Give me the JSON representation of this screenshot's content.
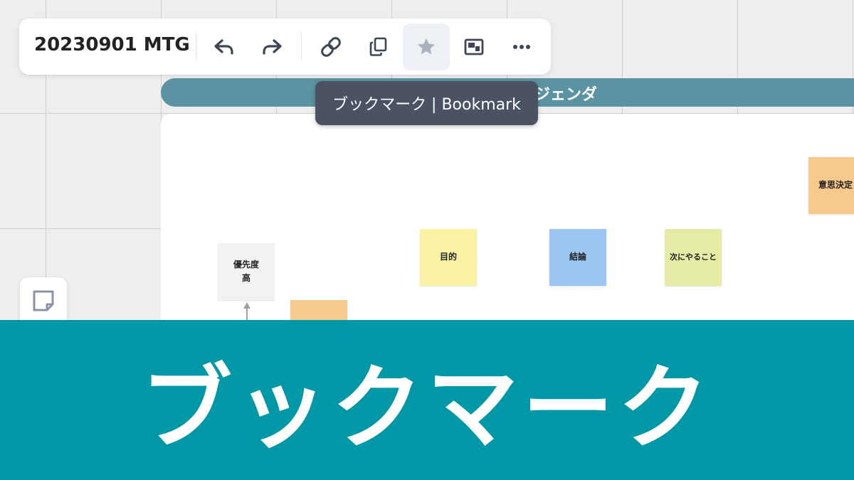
{
  "toolbar": {
    "title": "20230901 MTG",
    "buttons": {
      "undo": "undo",
      "redo": "redo",
      "link": "link",
      "copy": "copy",
      "bookmark": "bookmark",
      "frame": "frame",
      "more": "more"
    }
  },
  "tooltip": {
    "text": "ブックマーク | Bookmark"
  },
  "board": {
    "agenda_title": "ジェンダ",
    "stickies": [
      {
        "text_line1": "優先度",
        "text_line2": "高",
        "color": "#f2f2f2"
      },
      {
        "text": "意思決定",
        "color": "#f7c98d"
      },
      {
        "text": "目的",
        "color": "#fbf3a3"
      },
      {
        "text": "結論",
        "color": "#9cc6f2"
      },
      {
        "text": "次にやること",
        "color": "#e6eba6"
      },
      {
        "text": "",
        "color": "#f7c98d"
      }
    ]
  },
  "banner": {
    "text": "ブックマーク"
  },
  "colors": {
    "accent": "#0097a7",
    "agenda_bar": "#5b93a2",
    "tooltip_bg": "#4b5263",
    "icon": "#3e4656"
  }
}
